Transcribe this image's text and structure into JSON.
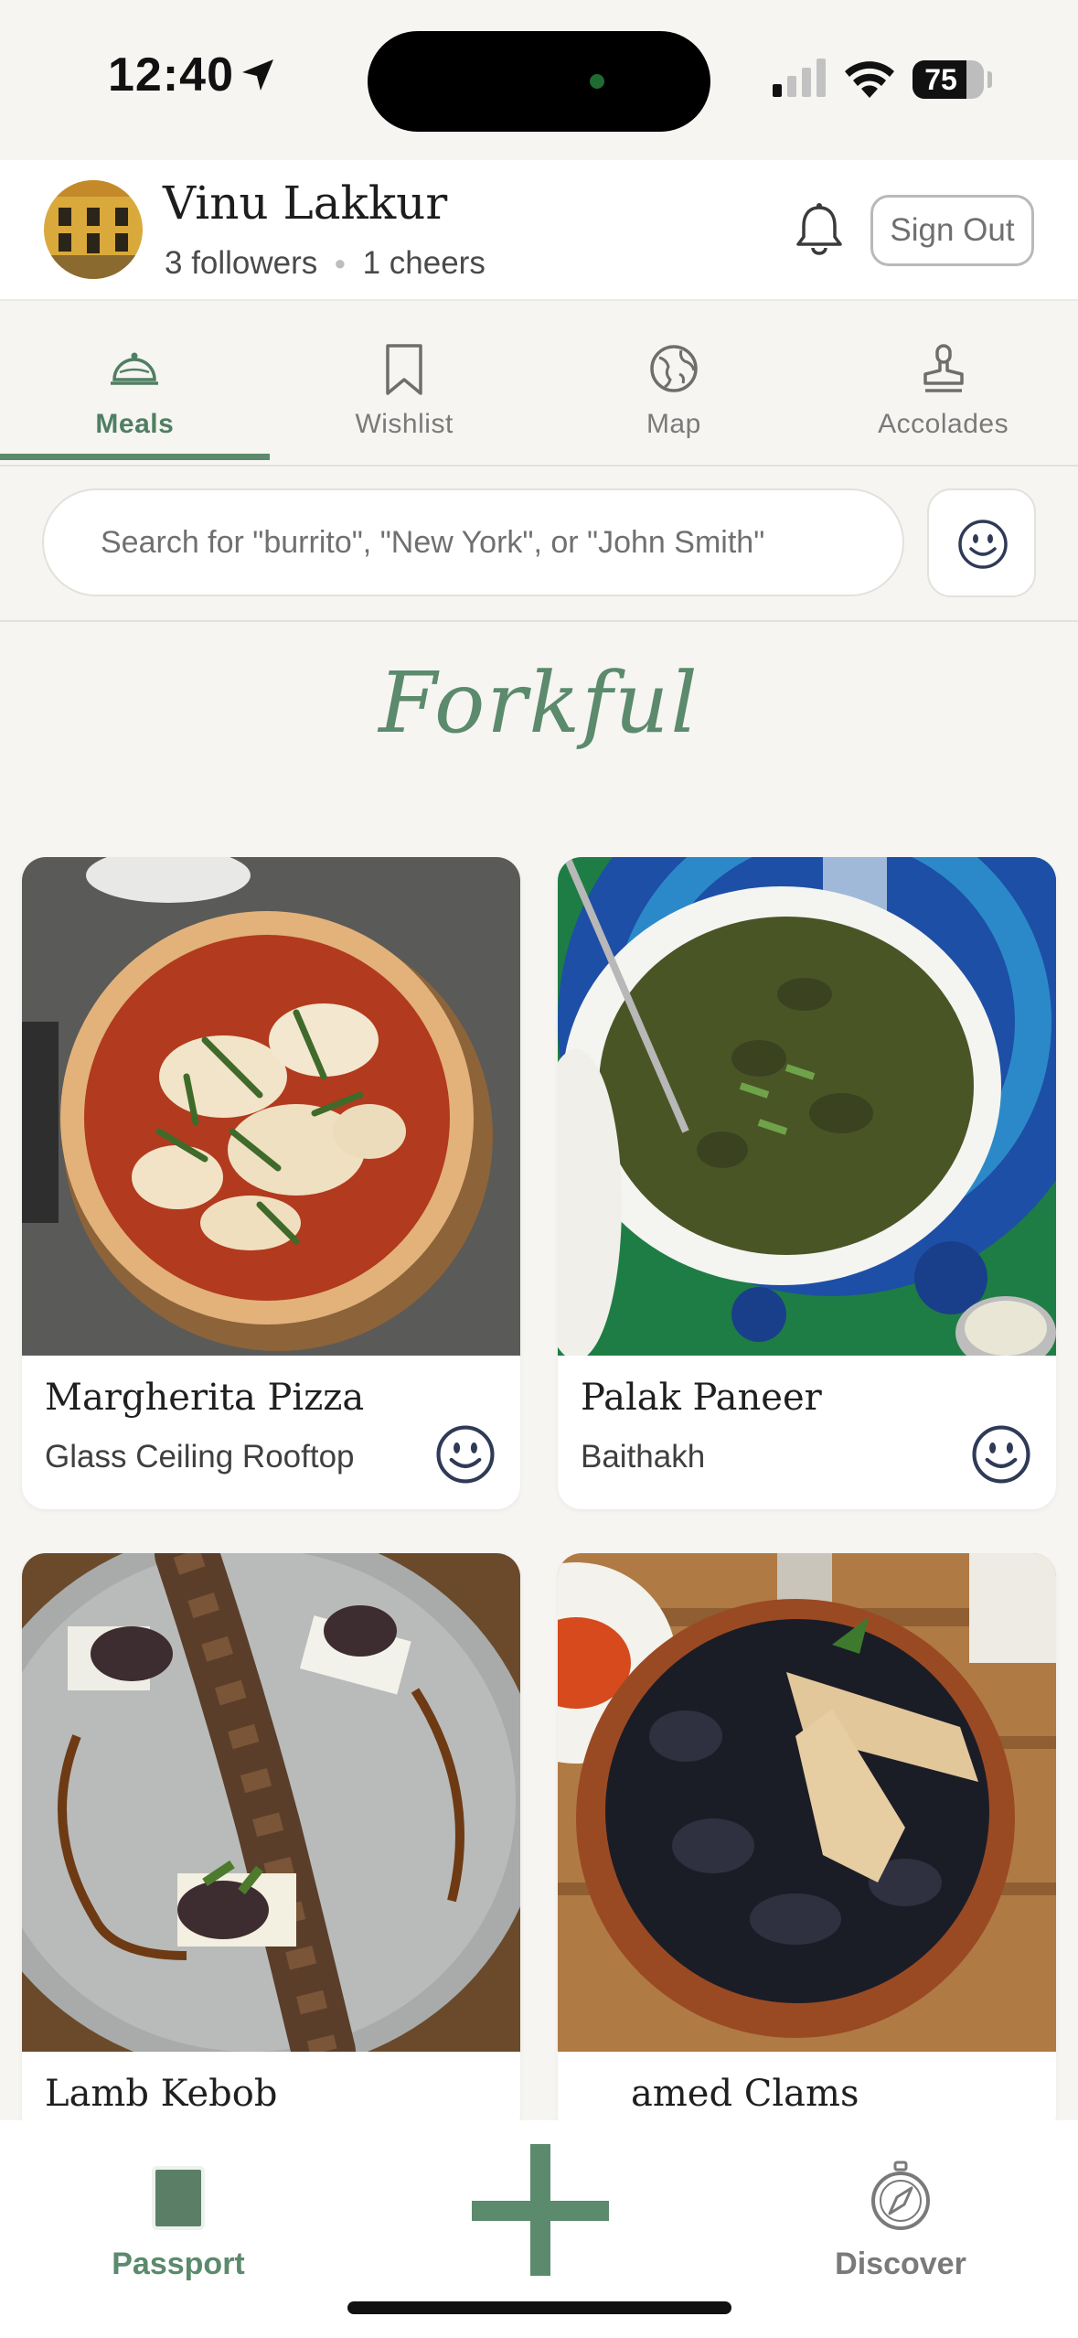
{
  "status_bar": {
    "time": "12:40",
    "battery": "75",
    "battery_level": 0.75
  },
  "profile": {
    "name": "Vinu Lakkur",
    "followers": "3 followers",
    "cheers": "1 cheers",
    "sign_out_label": "Sign Out",
    "icons": {
      "notifications": "bell-icon"
    }
  },
  "tabs": [
    {
      "label": "Meals",
      "icon": "cloche-icon",
      "active": true
    },
    {
      "label": "Wishlist",
      "icon": "bookmark-icon",
      "active": false
    },
    {
      "label": "Map",
      "icon": "globe-icon",
      "active": false
    },
    {
      "label": "Accolades",
      "icon": "stamp-icon",
      "active": false
    }
  ],
  "search": {
    "placeholder": "Search for \"burrito\", \"New York\", or \"John Smith\"",
    "filter_icon": "smiley-icon"
  },
  "logo": "Forkful",
  "meals": [
    {
      "dish": "Margherita Pizza",
      "venue": "Glass Ceiling Rooftop",
      "reaction": "smiley-icon"
    },
    {
      "dish": "Palak Paneer",
      "venue": "Baithakh",
      "reaction": "smiley-icon"
    },
    {
      "dish": "Lamb Kebob",
      "venue": ""
    },
    {
      "dish": "Steamed Clams",
      "visible_text": "amed Clams",
      "venue": ""
    }
  ],
  "bottom_nav": {
    "passport_label": "Passport",
    "add_icon": "plus-icon",
    "discover_label": "Discover",
    "discover_icon": "compass-icon"
  },
  "colors": {
    "accent": "#5b8a6c",
    "background": "#f6f5f2",
    "surface": "#ffffff"
  }
}
